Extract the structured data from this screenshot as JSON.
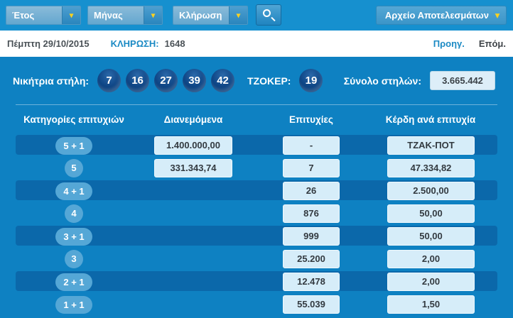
{
  "toolbar": {
    "dropdowns": [
      {
        "label": "Έτος"
      },
      {
        "label": "Μήνας"
      },
      {
        "label": "Κλήρωση"
      }
    ],
    "archive_button_label": "Αρχείο Αποτελεσμάτων"
  },
  "draw_info": {
    "date": "Πέμπτη 29/10/2015",
    "draw_label": "ΚΛΗΡΩΣΗ:",
    "draw_number": "1648",
    "prev_label": "Προηγ.",
    "next_label": "Επόμ."
  },
  "results": {
    "winning_label": "Νικήτρια στήλη:",
    "numbers": [
      "7",
      "16",
      "27",
      "39",
      "42"
    ],
    "joker_label": "ΤΖΟΚΕΡ:",
    "joker_number": "19",
    "total_label": "Σύνολο στηλών:",
    "total_value": "3.665.442"
  },
  "table": {
    "headers": [
      "Κατηγορίες επιτυχιών",
      "Διανεμόμενα",
      "Επιτυχίες",
      "Κέρδη ανά επιτυχία"
    ],
    "rows": [
      {
        "category": "5 + 1",
        "distributed": "1.400.000,00",
        "winners": "-",
        "prize": "ΤΖΑΚ-ΠΟΤ",
        "highlight": true
      },
      {
        "category": "5",
        "distributed": "331.343,74",
        "winners": "7",
        "prize": "47.334,82",
        "highlight": false
      },
      {
        "category": "4 + 1",
        "distributed": "",
        "winners": "26",
        "prize": "2.500,00",
        "highlight": true
      },
      {
        "category": "4",
        "distributed": "",
        "winners": "876",
        "prize": "50,00",
        "highlight": false
      },
      {
        "category": "3 + 1",
        "distributed": "",
        "winners": "999",
        "prize": "50,00",
        "highlight": true
      },
      {
        "category": "3",
        "distributed": "",
        "winners": "25.200",
        "prize": "2,00",
        "highlight": false
      },
      {
        "category": "2 + 1",
        "distributed": "",
        "winners": "12.478",
        "prize": "2,00",
        "highlight": true
      },
      {
        "category": "1 + 1",
        "distributed": "",
        "winners": "55.039",
        "prize": "1,50",
        "highlight": false
      }
    ]
  },
  "colors": {
    "toolbar_bg": "#1690cf",
    "content_bg": "#0e81c2",
    "highlight_band": "#0b68aa",
    "ball": "#0d4484",
    "badge": "#55a7d6",
    "value_box_bg": "#d6edf9",
    "accent_yellow": "#ffd21e",
    "link_blue": "#1b8ac4"
  }
}
